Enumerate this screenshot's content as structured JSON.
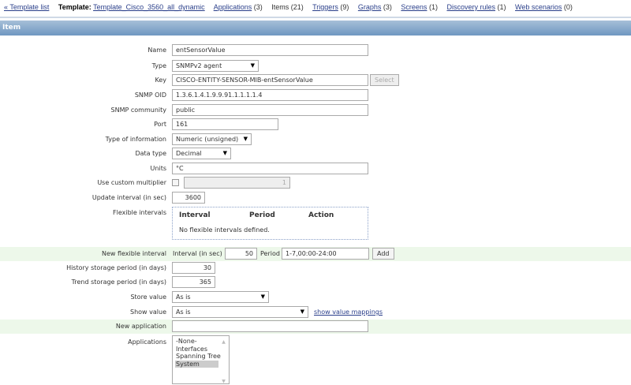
{
  "nav": {
    "back_label": "« Template list",
    "template_prefix": "Template:",
    "template_name": "Template_Cisco_3560_all_dynamic",
    "items": [
      {
        "label": "Applications",
        "count": "(3)",
        "link": true
      },
      {
        "label": "Items",
        "count": "(21)",
        "link": false
      },
      {
        "label": "Triggers",
        "count": "(9)",
        "link": true
      },
      {
        "label": "Graphs",
        "count": "(3)",
        "link": true
      },
      {
        "label": "Screens",
        "count": "(1)",
        "link": true
      },
      {
        "label": "Discovery rules",
        "count": "(1)",
        "link": true
      },
      {
        "label": "Web scenarios",
        "count": "(0)",
        "link": true
      }
    ]
  },
  "header": {
    "title": "Item"
  },
  "form": {
    "name": {
      "label": "Name",
      "value": "entSensorValue"
    },
    "type": {
      "label": "Type",
      "value": "SNMPv2 agent"
    },
    "key": {
      "label": "Key",
      "value": "CISCO-ENTITY-SENSOR-MIB-entSensorValue",
      "button": "Select"
    },
    "oid": {
      "label": "SNMP OID",
      "value": "1.3.6.1.4.1.9.9.91.1.1.1.1.4"
    },
    "community": {
      "label": "SNMP community",
      "value": "public"
    },
    "port": {
      "label": "Port",
      "value": "161"
    },
    "info_type": {
      "label": "Type of information",
      "value": "Numeric (unsigned)"
    },
    "data_type": {
      "label": "Data type",
      "value": "Decimal"
    },
    "units": {
      "label": "Units",
      "value": "°C"
    },
    "multiplier": {
      "label": "Use custom multiplier",
      "value": "1",
      "checked": false
    },
    "update": {
      "label": "Update interval (in sec)",
      "value": "3600"
    },
    "flexible": {
      "label": "Flexible intervals",
      "col_interval": "Interval",
      "col_period": "Period",
      "col_action": "Action",
      "empty": "No flexible intervals defined."
    },
    "new_flexible": {
      "label": "New flexible interval",
      "interval_label": "Interval (in sec)",
      "interval_value": "50",
      "period_label": "Period",
      "period_value": "1-7,00:00-24:00",
      "add_button": "Add"
    },
    "history": {
      "label": "History storage period (in days)",
      "value": "30"
    },
    "trends": {
      "label": "Trend storage period (in days)",
      "value": "365"
    },
    "store": {
      "label": "Store value",
      "value": "As is"
    },
    "show": {
      "label": "Show value",
      "value": "As is",
      "link": "show value mappings"
    },
    "new_app": {
      "label": "New application",
      "value": ""
    },
    "applications": {
      "label": "Applications",
      "options": [
        "-None-",
        "Interfaces",
        "Spanning Tree",
        "System"
      ],
      "selected": "System"
    }
  }
}
